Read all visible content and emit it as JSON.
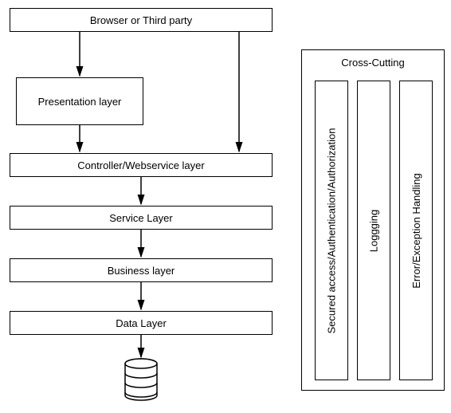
{
  "boxes": {
    "browser": "Browser or Third party",
    "presentation": "Presentation layer",
    "controller": "Controller/Webservice layer",
    "service": "Service Layer",
    "business": "Business layer",
    "data": "Data Layer"
  },
  "cross_cutting": {
    "title": "Cross-Cutting",
    "columns": {
      "security": "Secured access/Authentication/Authorization",
      "logging": "Loggging",
      "error": "Error/Exception Handling"
    }
  }
}
